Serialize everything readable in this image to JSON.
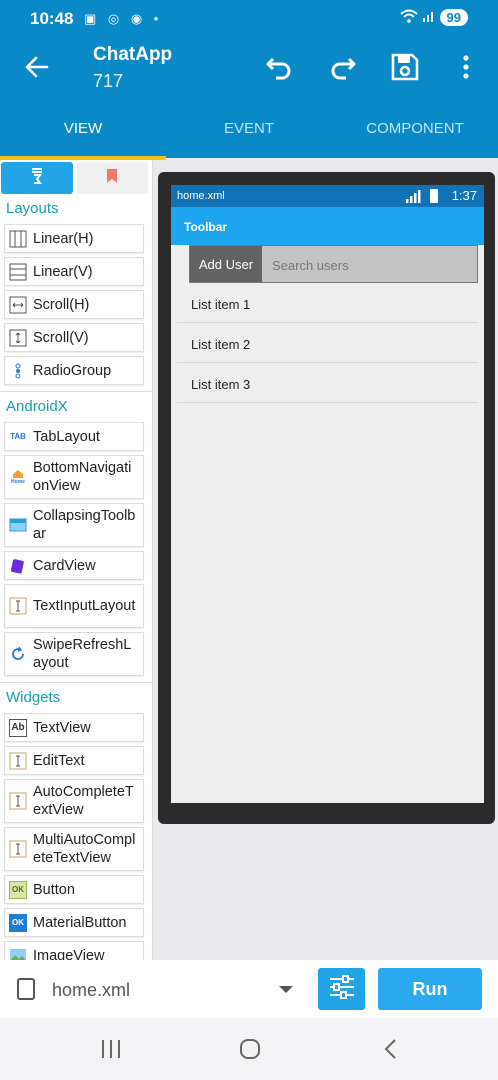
{
  "status_bar": {
    "time": "10:48",
    "battery": "99"
  },
  "app_bar": {
    "title": "ChatApp",
    "subtitle": "717"
  },
  "tabs": [
    {
      "label": "VIEW",
      "active": true
    },
    {
      "label": "EVENT",
      "active": false
    },
    {
      "label": "COMPONENT",
      "active": false
    }
  ],
  "palette": {
    "sections": {
      "layouts": "Layouts",
      "androidx": "AndroidX",
      "widgets": "Widgets"
    },
    "layouts": [
      "Linear(H)",
      "Linear(V)",
      "Scroll(H)",
      "Scroll(V)",
      "RadioGroup"
    ],
    "androidx": [
      "TabLayout",
      "BottomNavigationView",
      "CollapsingToolbar",
      "CardView",
      "TextInputLayout",
      "SwipeRefreshLayout"
    ],
    "widgets": [
      "TextView",
      "EditText",
      "AutoCompleteTextView",
      "MultiAutoCompleteTextView",
      "Button",
      "MaterialButton",
      "ImageView"
    ],
    "icon_labels": {
      "tab": "TAB",
      "home": "Home",
      "textview": "Ab",
      "button": "OK",
      "materialbutton": "OK"
    }
  },
  "preview": {
    "file": "home.xml",
    "time": "1:37",
    "toolbar_title": "Toolbar",
    "add_user_label": "Add User",
    "search_placeholder": "Search users",
    "list_items": [
      "List item 1",
      "List item 2",
      "List item 3"
    ]
  },
  "bottom_bar": {
    "file_name": "home.xml",
    "run_label": "Run"
  },
  "colors": {
    "primary": "#0a89c8",
    "accent": "#f4c21b",
    "section": "#15a0a8",
    "button": "#2aa9ee"
  }
}
